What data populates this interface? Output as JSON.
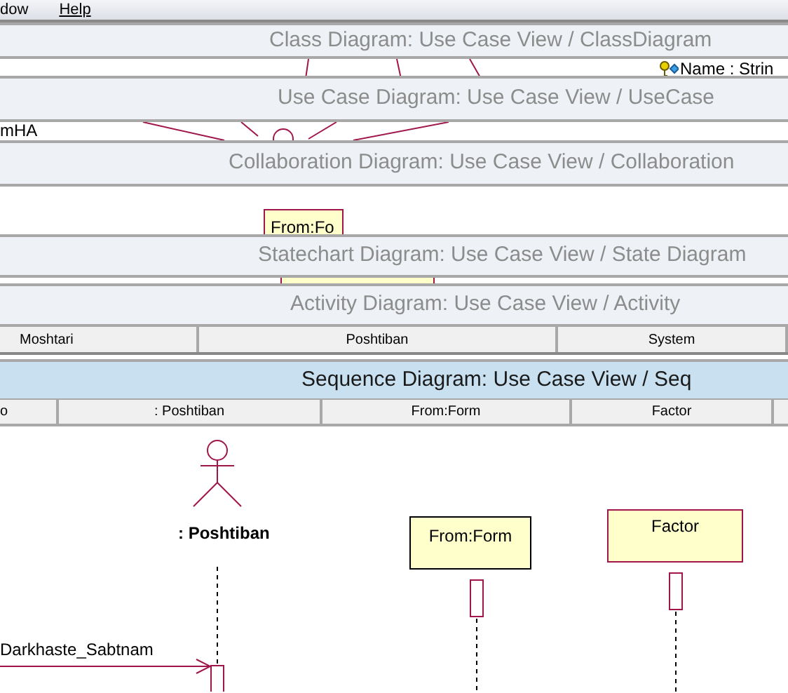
{
  "menu": [
    {
      "label": "dow",
      "hotkey": false
    },
    {
      "label": "Help",
      "hotkey": true
    }
  ],
  "windows": [
    {
      "kind": "class",
      "title": "Class Diagram: Use Case View / ClassDiagram",
      "selected": false,
      "attribute": "Name : Strin"
    },
    {
      "kind": "usecase",
      "title": "Use Case Diagram: Use Case View / UseCase",
      "selected": false,
      "fragment": "mHA"
    },
    {
      "kind": "collaboration",
      "title": "Collaboration Diagram: Use Case View / Collaboration",
      "selected": false,
      "object": "From:Fo"
    },
    {
      "kind": "statechart",
      "title": "Statechart Diagram: Use Case View / State Diagram",
      "selected": false
    },
    {
      "kind": "activity",
      "title": "Activity Diagram: Use Case View / Activity",
      "selected": false,
      "lanes": [
        "Moshtari",
        "Poshtiban",
        "System"
      ]
    },
    {
      "kind": "sequence",
      "title": "Sequence Diagram: Use Case View / Seq",
      "selected": true,
      "columns": [
        "o",
        ": Poshtiban",
        "From:Form",
        "Factor"
      ],
      "actor": ": Poshtiban",
      "objects": [
        {
          "name": "From:Form",
          "color": "#000000"
        },
        {
          "name": "Factor",
          "color": "#a0164b"
        }
      ],
      "message": "Darkhaste_Sabtnam"
    }
  ]
}
